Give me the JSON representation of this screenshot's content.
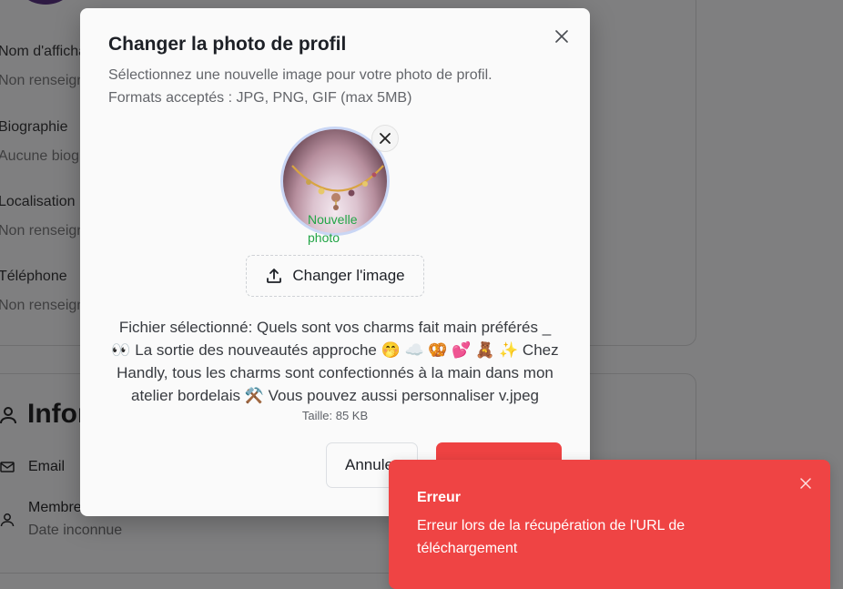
{
  "background": {
    "fields": [
      {
        "label": "Nom d'affichage",
        "value": "Non renseigné"
      },
      {
        "label": "Biographie",
        "value": "Aucune biographie"
      },
      {
        "label": "Localisation",
        "value": "Non renseigné"
      },
      {
        "label": "Téléphone",
        "value": "Non renseigné"
      }
    ],
    "section_title": "Informations",
    "rows": [
      {
        "label": "Email",
        "value": ""
      },
      {
        "label": "Membre depuis",
        "value": "Date inconnue"
      }
    ]
  },
  "modal": {
    "title": "Changer la photo de profil",
    "description": "Sélectionnez une nouvelle image pour votre photo de profil. Formats acceptés : JPG, PNG, GIF (max 5MB)",
    "photo_label": "Nouvelle photo",
    "change_button": "Changer l'image",
    "file_info": "Fichier sélectionné: Quels sont vos charms fait main préférés _ 👀 La sortie des nouveautés approche 🤭 ☁️ 🥨 💕 🧸 ✨ Chez Handly, tous les charms sont confectionnés à la main dans mon atelier bordelais ⚒️ Vous pouvez aussi personnaliser v.jpeg",
    "file_size": "Taille: 85 KB",
    "cancel_button": "Annuler",
    "save_button": ""
  },
  "toast": {
    "title": "Erreur",
    "message": "Erreur lors de la récupération de l'URL de téléchargement"
  },
  "colors": {
    "accent_red": "#ef4444",
    "success_green": "#22a546"
  }
}
